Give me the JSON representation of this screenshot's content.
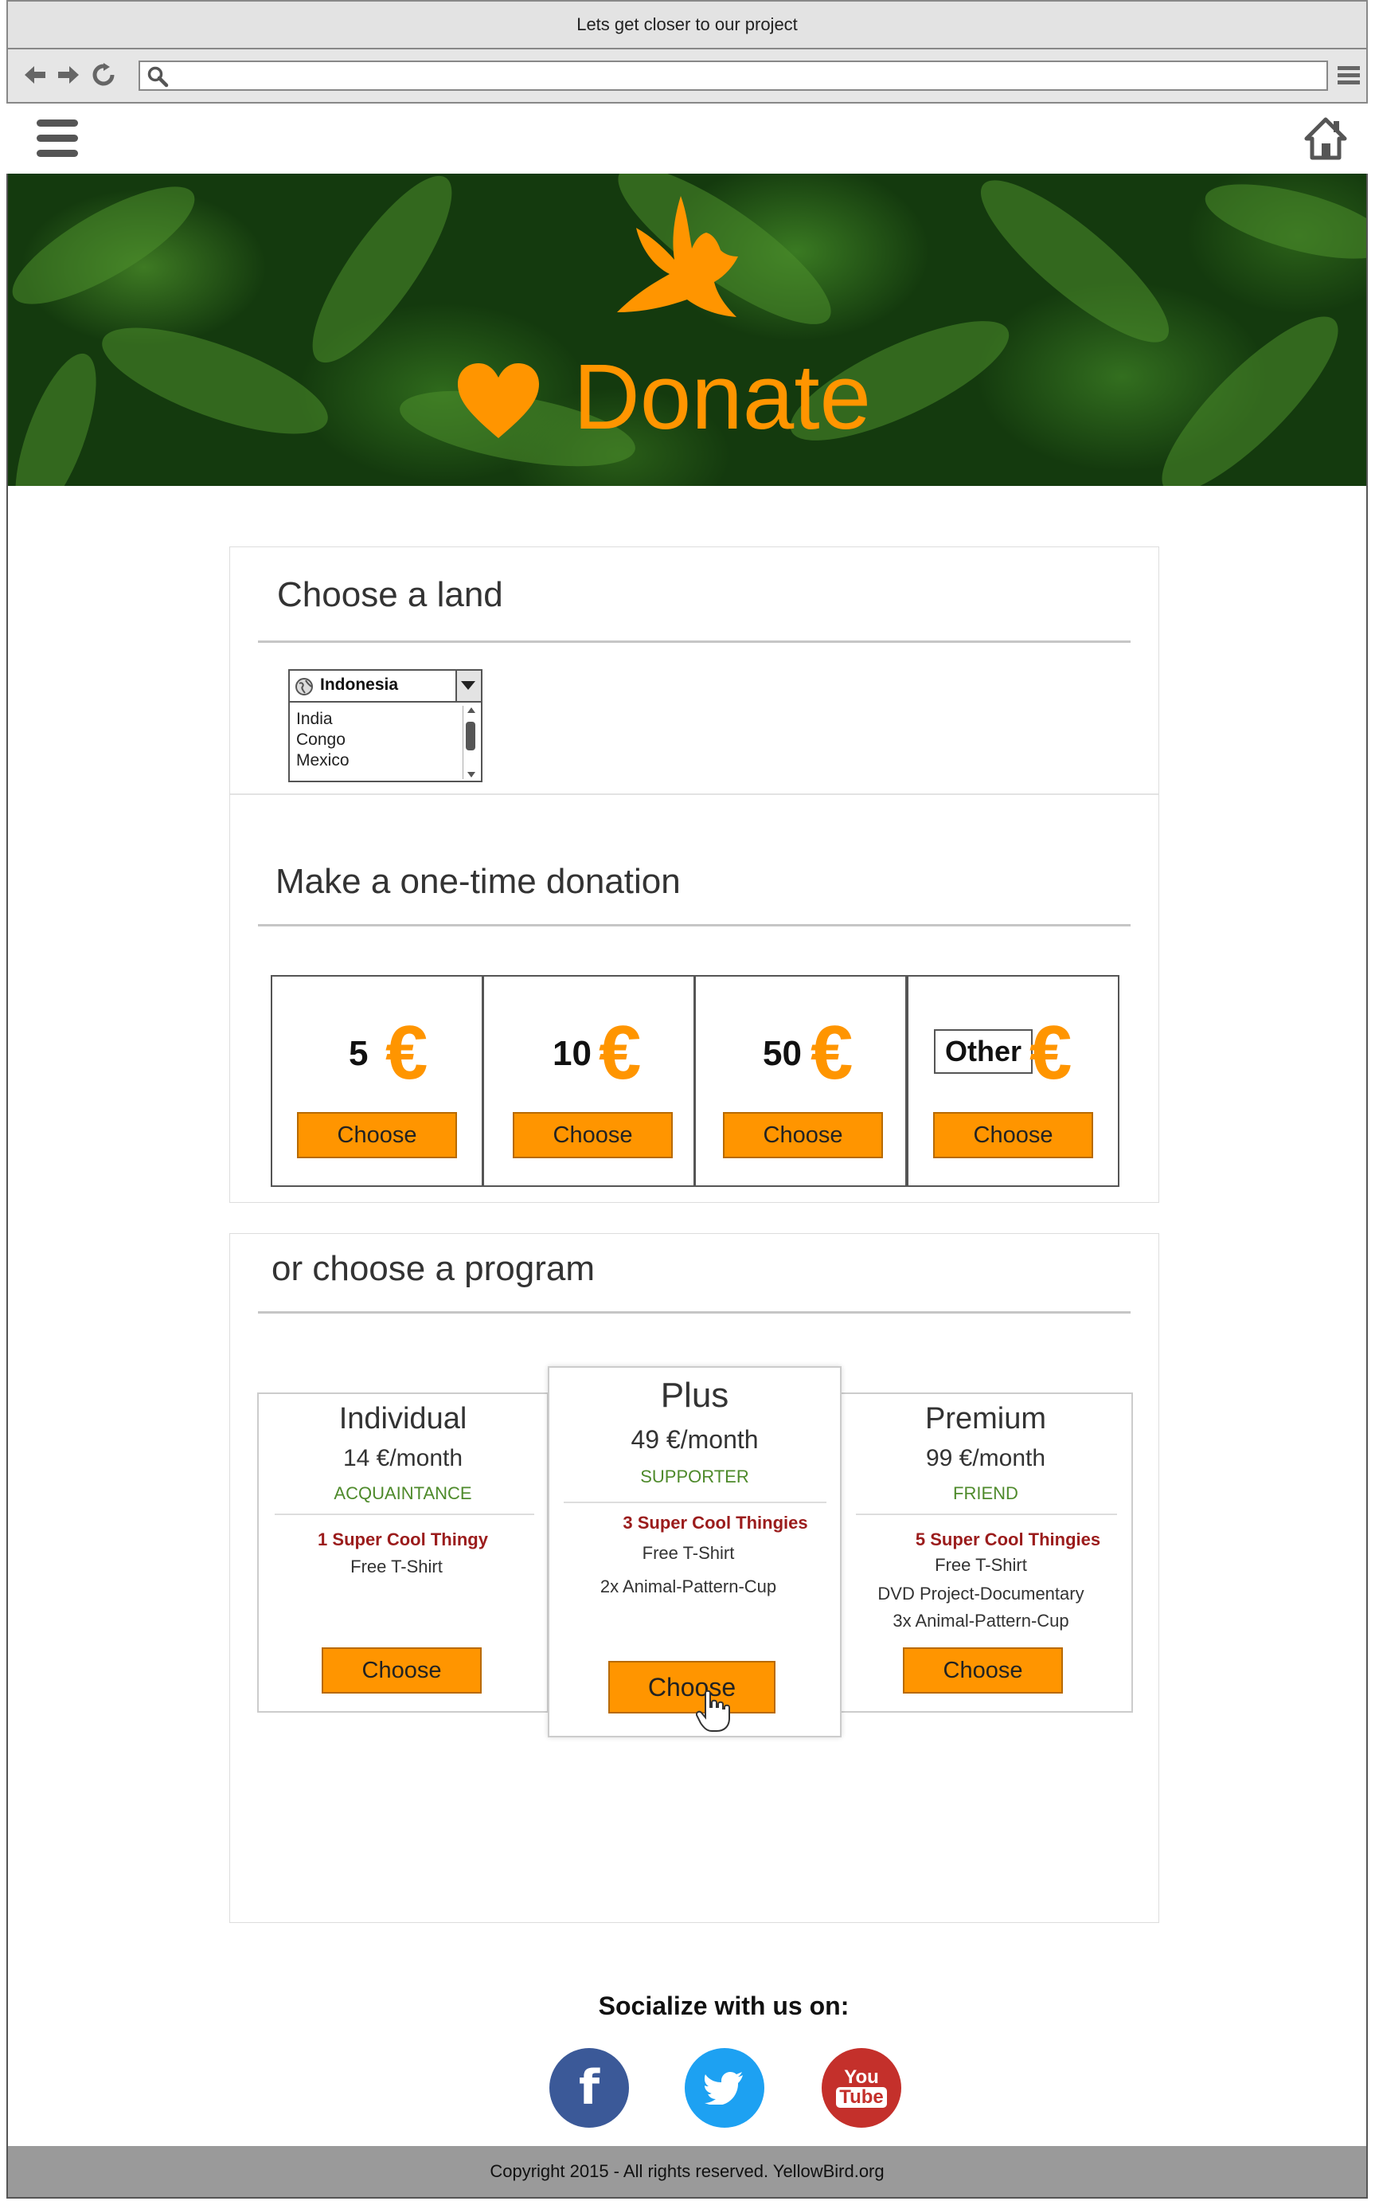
{
  "browser": {
    "window_title": "Lets get closer to our project",
    "url": "",
    "icons": [
      "back-icon",
      "forward-icon",
      "reload-icon",
      "search-icon",
      "menu-icon"
    ]
  },
  "app": {
    "menu_icon": "hamburger-icon",
    "home_icon": "home-icon"
  },
  "hero": {
    "title": "Donate",
    "icons": [
      "dove-icon",
      "heart-icon"
    ],
    "accent": "#ff9500"
  },
  "land": {
    "title": "Choose a land",
    "selected": "Indonesia",
    "options": [
      "India",
      "Congo",
      "Mexico"
    ]
  },
  "one_time": {
    "title": "Make a one-time donation",
    "currency": "€",
    "amounts": [
      {
        "value": "5",
        "button": "Choose"
      },
      {
        "value": "10",
        "button": "Choose"
      },
      {
        "value": "50",
        "button": "Choose"
      },
      {
        "value": "Other",
        "button": "Choose"
      }
    ]
  },
  "programs": {
    "title": "or choose a program",
    "items": [
      {
        "name": "Individual",
        "price": "14 €/month",
        "level": "ACQUAINTANCE",
        "headline": "1 Super Cool Thingy",
        "perks": [
          "Free T-Shirt"
        ],
        "button": "Choose"
      },
      {
        "name": "Plus",
        "price": "49 €/month",
        "level": "SUPPORTER",
        "headline": "3 Super Cool Thingies",
        "perks": [
          "Free T-Shirt",
          "2x Animal-Pattern-Cup"
        ],
        "button": "Choose"
      },
      {
        "name": "Premium",
        "price": "99 €/month",
        "level": "FRIEND",
        "headline": "5 Super Cool Thingies",
        "perks": [
          "Free T-Shirt",
          "DVD Project-Documentary",
          "3x Animal-Pattern-Cup"
        ],
        "button": "Choose"
      }
    ]
  },
  "social": {
    "title": "Socialize with us on:",
    "items": [
      {
        "name": "facebook-icon",
        "color": "#3b5998",
        "glyph": "f"
      },
      {
        "name": "twitter-icon",
        "color": "#1da1f2",
        "glyph": ""
      },
      {
        "name": "youtube-icon",
        "color": "#c4302b",
        "glyph1": "You",
        "glyph2": "Tube"
      }
    ]
  },
  "footer": {
    "text": "Copyright 2015  - All rights reserved. YellowBird.org"
  }
}
